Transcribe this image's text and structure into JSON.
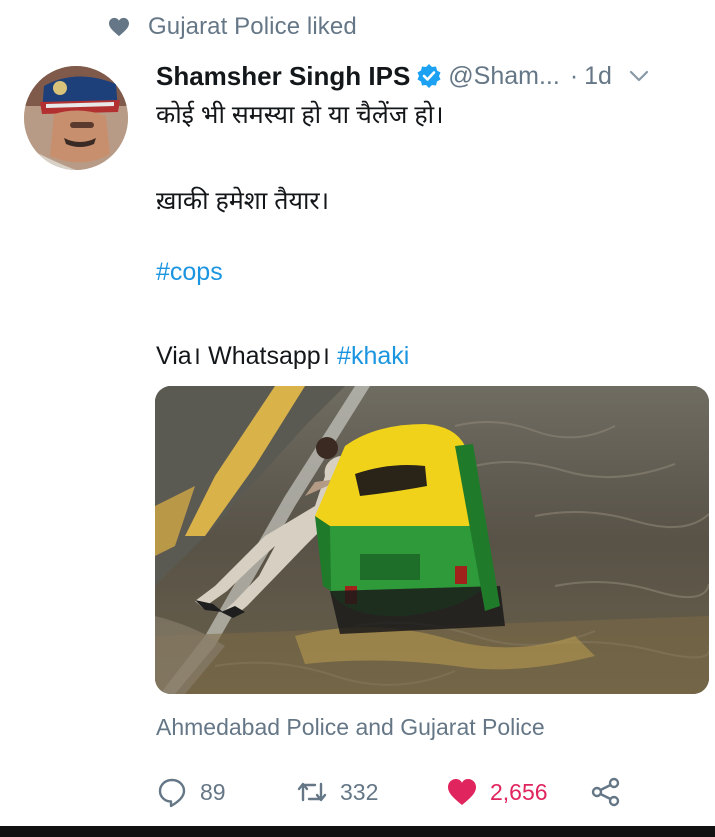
{
  "social_context": {
    "text": "Gujarat  Police liked"
  },
  "author": {
    "name": "Shamsher Singh IPS",
    "handle": "@Sham...",
    "separator": "·",
    "time": "1d"
  },
  "tweet": {
    "line1": "कोई भी समस्या हो या चैलेंज हो।",
    "line2": "ख़ाकी हमेशा तैयार।",
    "hashtag1": "#cops",
    "line4_prefix": "Via। Whatsapp। ",
    "hashtag2": "#khaki"
  },
  "media": {
    "tagged": "Ahmedabad Police and Gujarat  Police"
  },
  "actions": {
    "replies": "89",
    "retweets": "332",
    "likes": "2,656"
  },
  "icons": [
    "heart-icon",
    "verified-badge-icon",
    "chevron-down-icon",
    "reply-icon",
    "retweet-icon",
    "like-heart-icon",
    "share-icon"
  ],
  "colors": {
    "link": "#1b95e0",
    "like": "#e0245e",
    "secondary": "#657786",
    "verified": "#1da1f2"
  }
}
